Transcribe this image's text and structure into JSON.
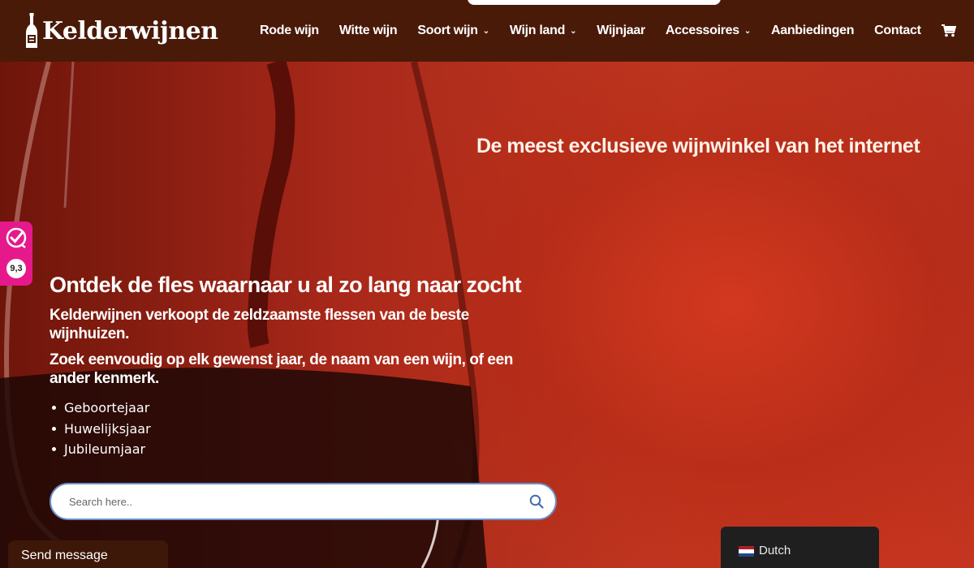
{
  "header": {
    "logo_text": "Kelderwijnen",
    "nav": [
      {
        "label": "Rode wijn",
        "has_dropdown": false
      },
      {
        "label": "Witte wijn",
        "has_dropdown": false
      },
      {
        "label": "Soort wijn",
        "has_dropdown": true
      },
      {
        "label": "Wijn land",
        "has_dropdown": true
      },
      {
        "label": "Wijnjaar",
        "has_dropdown": false
      },
      {
        "label": "Accessoires",
        "has_dropdown": true
      },
      {
        "label": "Aanbiedingen",
        "has_dropdown": false
      },
      {
        "label": "Contact",
        "has_dropdown": false
      }
    ],
    "cart_icon": "cart-icon",
    "background_color": "#4a1a08"
  },
  "hero": {
    "tagline": "De meest exclusieve wijnwinkel van het internet",
    "heading": "Ontdek de fles waarnaar u al zo lang naar zocht",
    "paragraph1": "Kelderwijnen verkoopt de zeldzaamste flessen van de beste wijnhuizen.",
    "paragraph2": "Zoek eenvoudig op elk gewenst jaar, de naam van een wijn, of een ander kenmerk.",
    "bullets": [
      "Geboortejaar",
      "Huwelijksjaar",
      "Jubileumjaar"
    ]
  },
  "search": {
    "placeholder": "Search here..",
    "value": "",
    "icon": "search-icon"
  },
  "review_badge": {
    "score": "9,3",
    "icon": "checkmark-badge-icon",
    "color": "#e6198c"
  },
  "chat": {
    "label": "Send message"
  },
  "language": {
    "label": "Dutch",
    "flag_icon": "netherlands-flag-icon"
  }
}
